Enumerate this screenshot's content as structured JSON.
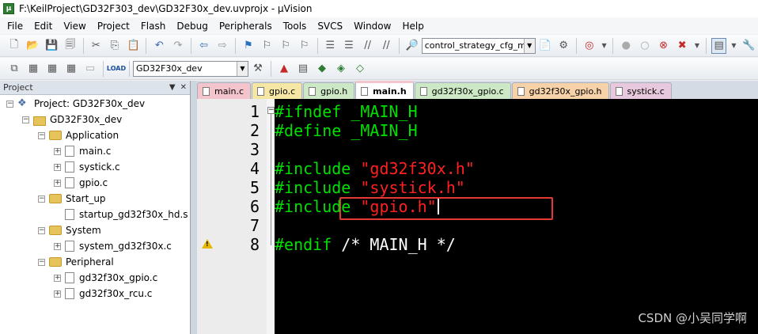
{
  "window": {
    "title": "F:\\KeilProject\\GD32F303_dev\\GD32F30x_dev.uvprojx - µVision"
  },
  "menu": [
    "File",
    "Edit",
    "View",
    "Project",
    "Flash",
    "Debug",
    "Peripherals",
    "Tools",
    "SVCS",
    "Window",
    "Help"
  ],
  "toolbar1": {
    "find_combo": "control_strategy_cfg_m_c"
  },
  "toolbar2": {
    "target_combo": "GD32F30x_dev"
  },
  "project_panel": {
    "title": "Project",
    "pin_glyph": "▼",
    "close_glyph": "✕",
    "tree": [
      {
        "label": "Project: GD32F30x_dev",
        "type": "project",
        "expander": "−"
      },
      {
        "label": "GD32F30x_dev",
        "type": "target",
        "expander": "−"
      },
      {
        "label": "Application",
        "type": "folder",
        "expander": "−"
      },
      {
        "label": "main.c",
        "type": "file",
        "expander": "+"
      },
      {
        "label": "systick.c",
        "type": "file",
        "expander": "+"
      },
      {
        "label": "gpio.c",
        "type": "file",
        "expander": "+"
      },
      {
        "label": "Start_up",
        "type": "folder",
        "expander": "−"
      },
      {
        "label": "startup_gd32f30x_hd.s",
        "type": "file",
        "expander": ""
      },
      {
        "label": "System",
        "type": "folder",
        "expander": "−"
      },
      {
        "label": "system_gd32f30x.c",
        "type": "file",
        "expander": "+"
      },
      {
        "label": "Peripheral",
        "type": "folder",
        "expander": "−"
      },
      {
        "label": "gd32f30x_gpio.c",
        "type": "file",
        "expander": "+"
      },
      {
        "label": "gd32f30x_rcu.c",
        "type": "file",
        "expander": "+"
      }
    ]
  },
  "tabs": [
    {
      "label": "main.c",
      "color": "#f4c4cc",
      "active": false
    },
    {
      "label": "gpio.c",
      "color": "#f5e7a3",
      "active": false
    },
    {
      "label": "gpio.h",
      "color": "#cde8c5",
      "active": false
    },
    {
      "label": "main.h",
      "color": "#f4c4cc",
      "active": true
    },
    {
      "label": "gd32f30x_gpio.c",
      "color": "#cde8c5",
      "active": false
    },
    {
      "label": "gd32f30x_gpio.h",
      "color": "#f7d2a8",
      "active": false
    },
    {
      "label": "systick.c",
      "color": "#e7c8dc",
      "active": false
    }
  ],
  "editor": {
    "lines": [
      {
        "num": "1",
        "parts": [
          {
            "t": "#ifndef",
            "c": "kw"
          },
          {
            "t": " _MAIN_H",
            "c": "id"
          }
        ]
      },
      {
        "num": "2",
        "parts": [
          {
            "t": "#define",
            "c": "kw"
          },
          {
            "t": " _MAIN_H",
            "c": "id"
          }
        ]
      },
      {
        "num": "3",
        "parts": []
      },
      {
        "num": "4",
        "parts": [
          {
            "t": "#include ",
            "c": "kw"
          },
          {
            "t": "\"gd32f30x.h\"",
            "c": "str"
          }
        ]
      },
      {
        "num": "5",
        "parts": [
          {
            "t": "#include ",
            "c": "kw"
          },
          {
            "t": "\"systick.h\"",
            "c": "str"
          }
        ]
      },
      {
        "num": "6",
        "parts": [
          {
            "t": "#include ",
            "c": "kw"
          },
          {
            "t": "\"gpio.h\"",
            "c": "str"
          }
        ]
      },
      {
        "num": "7",
        "parts": []
      },
      {
        "num": "8",
        "parts": [
          {
            "t": "#endif",
            "c": "kw"
          },
          {
            "t": " /* MAIN_H */",
            "c": "cm"
          }
        ]
      }
    ],
    "caret_line": 6,
    "highlight_line": 6
  },
  "watermark": "CSDN @小吴同学啊"
}
